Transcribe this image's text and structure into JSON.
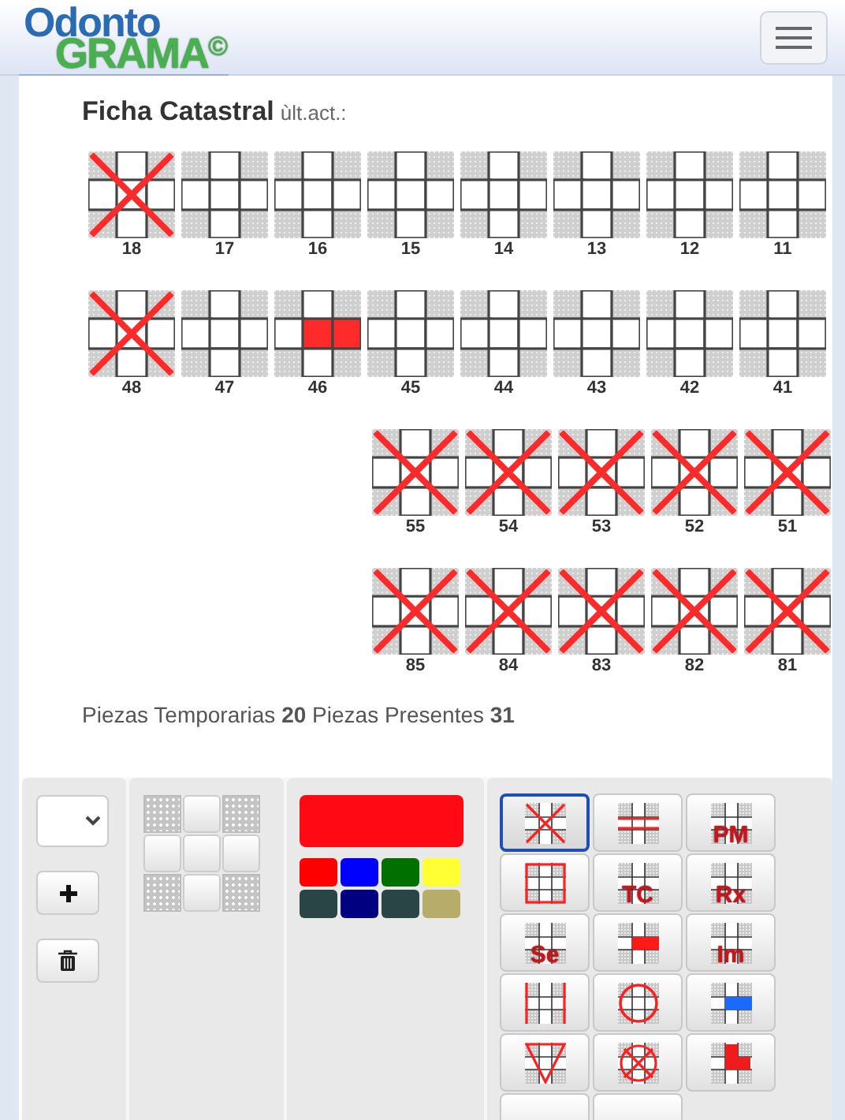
{
  "logo": {
    "line_1": "Odonto",
    "line_2": "GRAMA",
    "mark": "©"
  },
  "title": "Ficha Catastral",
  "updated_label": "ùlt.act.:",
  "tooth_rows": [
    {
      "kind": "permanent",
      "teeth": [
        {
          "number": "18",
          "missing": true,
          "restored": false
        },
        {
          "number": "17",
          "missing": false,
          "restored": false
        },
        {
          "number": "16",
          "missing": false,
          "restored": false
        },
        {
          "number": "15",
          "missing": false,
          "restored": false
        },
        {
          "number": "14",
          "missing": false,
          "restored": false
        },
        {
          "number": "13",
          "missing": false,
          "restored": false
        },
        {
          "number": "12",
          "missing": false,
          "restored": false
        },
        {
          "number": "11",
          "missing": false,
          "restored": false
        }
      ]
    },
    {
      "kind": "permanent",
      "teeth": [
        {
          "number": "48",
          "missing": true,
          "restored": false
        },
        {
          "number": "47",
          "missing": false,
          "restored": false
        },
        {
          "number": "46",
          "missing": false,
          "restored": true
        },
        {
          "number": "45",
          "missing": false,
          "restored": false
        },
        {
          "number": "44",
          "missing": false,
          "restored": false
        },
        {
          "number": "43",
          "missing": false,
          "restored": false
        },
        {
          "number": "42",
          "missing": false,
          "restored": false
        },
        {
          "number": "41",
          "missing": false,
          "restored": false
        }
      ]
    },
    {
      "kind": "temporary",
      "teeth": [
        {
          "number": "55",
          "missing": true,
          "restored": false
        },
        {
          "number": "54",
          "missing": true,
          "restored": false
        },
        {
          "number": "53",
          "missing": true,
          "restored": false
        },
        {
          "number": "52",
          "missing": true,
          "restored": false
        },
        {
          "number": "51",
          "missing": true,
          "restored": false
        }
      ]
    },
    {
      "kind": "temporary",
      "teeth": [
        {
          "number": "85",
          "missing": true,
          "restored": false
        },
        {
          "number": "84",
          "missing": true,
          "restored": false
        },
        {
          "number": "83",
          "missing": true,
          "restored": false
        },
        {
          "number": "82",
          "missing": true,
          "restored": false
        },
        {
          "number": "81",
          "missing": true,
          "restored": false
        }
      ]
    }
  ],
  "summary": "Piezas Temporarias **20** Piezas Presentes **31**",
  "current_swatch": {
    "color": "#ff0a14"
  },
  "palette": [
    {
      "color": "#ff0000"
    },
    {
      "color": "#0000ff"
    },
    {
      "color": "#007000"
    },
    {
      "color": "#ffff33"
    },
    {
      "color": "#294545"
    },
    {
      "color": "#000080"
    },
    {
      "color": "#294545"
    },
    {
      "color": "#b5ad69"
    }
  ],
  "tools": [
    {
      "kind": "cross",
      "selected": true
    },
    {
      "kind": "bars",
      "selected": false
    },
    {
      "kind": "text",
      "label": "PM",
      "selected": false
    },
    {
      "kind": "frame",
      "selected": false
    },
    {
      "kind": "text",
      "label": "TC",
      "selected": false
    },
    {
      "kind": "text",
      "label": "Rx",
      "selected": false
    },
    {
      "kind": "text",
      "label": "Se",
      "selected": false
    },
    {
      "kind": "face",
      "color": "#ff1a1a",
      "selected": false
    },
    {
      "kind": "text",
      "label": "Im",
      "selected": false
    },
    {
      "kind": "sides",
      "selected": false
    },
    {
      "kind": "circle",
      "selected": false
    },
    {
      "kind": "face",
      "color": "#1a6aff",
      "selected": false
    },
    {
      "kind": "triangle",
      "selected": false
    },
    {
      "kind": "crossed-circle",
      "selected": false
    },
    {
      "kind": "corner",
      "selected": false
    },
    {
      "kind": "partial",
      "selected": false
    },
    {
      "kind": "partial",
      "selected": false
    }
  ]
}
